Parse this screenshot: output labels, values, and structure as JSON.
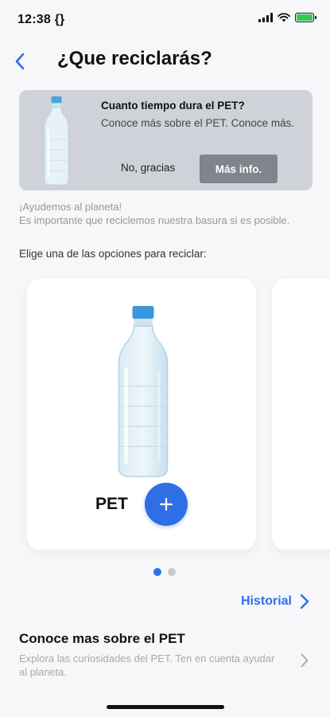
{
  "status_bar": {
    "time": "12:38 {}"
  },
  "header": {
    "title": "¿Que reciclarás?"
  },
  "banner": {
    "title": "Cuanto tiempo dura el PET?",
    "text": "Conoce más sobre el PET. Conoce más.",
    "dismiss_label": "No, gracias",
    "more_label": "Más info."
  },
  "intro": {
    "line1": "¡Ayudemos al planeta!",
    "line2": "Es importante que reciclemos nuestra basura si es posible.",
    "choose": "Elige una de las opciones para reciclar:"
  },
  "carousel": {
    "items": [
      {
        "label": "PET",
        "image_icon": "water-bottle"
      }
    ],
    "page_count": 2,
    "active_page": 1
  },
  "history": {
    "label": "Historial"
  },
  "info_section": {
    "title": "Conoce mas sobre el PET",
    "description": "Explora las curiosidades del PET. Ten en cuenta ayudar al planeta."
  },
  "colors": {
    "accent": "#2f6fe6",
    "banner_bg": "#cfd3d9",
    "more_button": "#7e858c",
    "battery": "#34c759"
  }
}
